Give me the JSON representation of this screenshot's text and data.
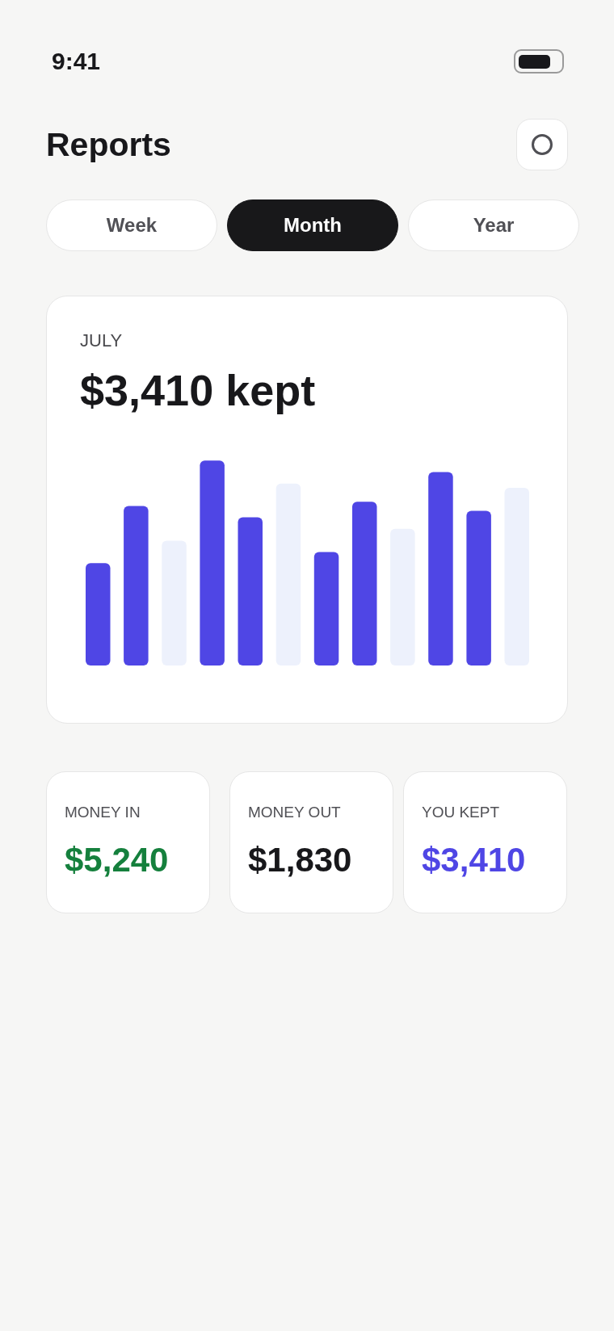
{
  "status_bar": {
    "time": "9:41"
  },
  "header": {
    "title": "Reports"
  },
  "period_tabs": [
    {
      "label": "Week",
      "selected": false
    },
    {
      "label": "Month",
      "selected": true
    },
    {
      "label": "Year",
      "selected": false
    }
  ],
  "summary_card": {
    "period": "JULY",
    "headline": "$3,410 kept"
  },
  "stats": [
    {
      "label": "MONEY IN",
      "value": "$5,240",
      "color": "#15803d"
    },
    {
      "label": "MONEY OUT",
      "value": "$1,830",
      "color": "#18181b"
    },
    {
      "label": "YOU KEPT",
      "value": "$3,410",
      "color": "#4f46e5"
    }
  ]
}
